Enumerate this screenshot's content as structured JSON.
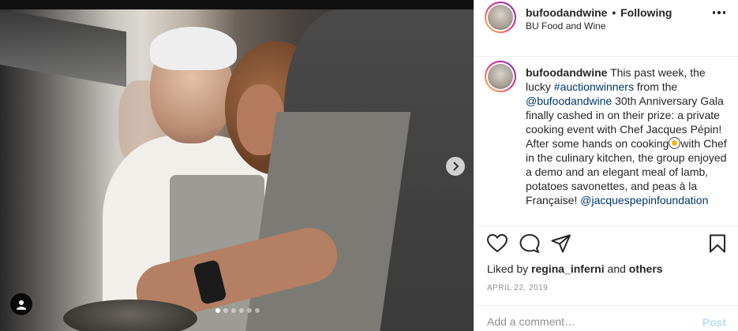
{
  "post": {
    "header": {
      "username": "bufoodandwine",
      "separator": "•",
      "follow_status": "Following",
      "subtitle": "BU Food and Wine"
    },
    "caption": {
      "username": "bufoodandwine",
      "text_1": " This past week, the lucky ",
      "hashtag": "#auctionwinners",
      "text_2": " from the ",
      "mention_1": "@bufoodandwine",
      "text_3": " 30th Anniversary Gala finally cashed in on their prize: a private cooking event with Chef Jacques Pépin! After some hands on cooking",
      "text_4": "with Chef in the culinary kitchen, the group enjoyed a demo and an elegant meal of lamb, potatoes savonettes, and peas à la Française! ",
      "mention_2": "@jacquespepinfoundation"
    },
    "likes": {
      "prefix": "Liked by ",
      "user": "regina_inferni",
      "middle": " and ",
      "others": "others"
    },
    "date": "APRIL 22, 2019",
    "comment": {
      "placeholder": "Add a comment…",
      "post_label": "Post"
    },
    "carousel": {
      "slide_count": 6,
      "active_index": 0
    },
    "icons": {
      "like": "heart-icon",
      "comment": "comment-icon",
      "share": "paper-plane-icon",
      "save": "bookmark-icon",
      "next": "chevron-right-icon",
      "tags": "user-tag-icon",
      "more": "more-options-icon"
    }
  }
}
